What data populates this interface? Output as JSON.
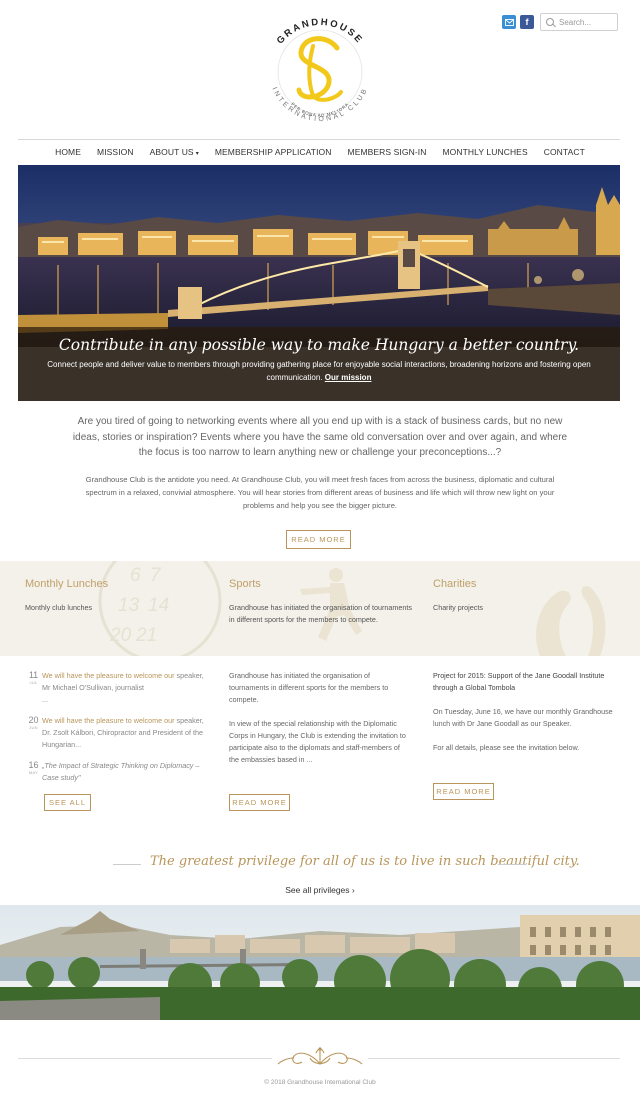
{
  "brand": {
    "name_top": "GRANDHOUSE",
    "name_bottom": "INTERNATIONAL CLUB",
    "motto": "PER BONA AD MELIORA",
    "accent": "#f2c81a"
  },
  "header": {
    "mail_icon": "mail-icon",
    "facebook_icon": "facebook-icon",
    "facebook_glyph": "f",
    "search_placeholder": "Search..."
  },
  "nav": {
    "items": [
      {
        "label": "HOME"
      },
      {
        "label": "MISSION"
      },
      {
        "label": "ABOUT US"
      },
      {
        "label": "MEMBERSHIP APPLICATION"
      },
      {
        "label": "MEMBERS SIGN-IN"
      },
      {
        "label": "MONTHLY LUNCHES"
      },
      {
        "label": "CONTACT"
      }
    ],
    "dropdown_caret": "▾"
  },
  "hero": {
    "tagline": "Contribute in any possible way to make Hungary a better country.",
    "text": "Connect people and deliver value to members through providing gathering place for enjoyable social interactions, broadening horizons and fostering open communication.",
    "link": "Our mission"
  },
  "intro": {
    "lead": "Are you tired of going to networking events where all you end up with is a stack of business cards, but no new ideas, stories or inspiration? Events where you have the same old conversation over and over again, and where the focus is too narrow to learn anything new or challenge your preconceptions...?",
    "body": "Grandhouse Club is the antidote you need. At Grandhouse Club, you will meet fresh faces from across the business, diplomatic and cultural spectrum in a relaxed, convivial atmosphere. You will hear stories from different areas of business and life which will throw new light on your problems and help you see the bigger picture.",
    "read_more": "READ MORE"
  },
  "band": {
    "lunches": {
      "title": "Monthly Lunches",
      "text": "Monthly club lunches"
    },
    "sports": {
      "title": "Sports",
      "text": "Grandhouse has initiated the organisation of tournaments in different sports for the members to compete."
    },
    "charities": {
      "title": "Charities",
      "text": "Charity projects"
    },
    "calendar_numbers": [
      "6",
      "7",
      "13",
      "14",
      "20",
      "21"
    ]
  },
  "news": {
    "items": [
      {
        "day": "11",
        "month": "JUL",
        "text": "We will have the pleasure to welcome our",
        "rest": "speaker, Mr Michael O'Sullivan, journalist",
        "tail": "..."
      },
      {
        "day": "20",
        "month": "JUN",
        "text": "We will have the pleasure to welcome our",
        "rest": "speaker, Dr. Zsolt Kálbori, Chiropractor and President of the Hungarian..."
      },
      {
        "day": "16",
        "month": "MAY",
        "text": "„The Impact of Strategic Thinking on Diplomacy – Case study\""
      }
    ],
    "see_all": "SEE ALL"
  },
  "sports_col": {
    "p1": "Grandhouse has initiated the organisation of tournaments in different sports for the members to compete.",
    "p2": "In view of the special relationship with the Diplomatic Corps in Hungary, the Club is extending the invitation to participate also to the diplomats and staff-members of the embassies based in ...",
    "read_more": "READ MORE"
  },
  "charity_col": {
    "title": "Project for 2015: Support of the Jane Goodall Institute through a Global Tombola",
    "p1": "On Tuesday, June 16, we have our monthly Grandhouse lunch with Dr Jane Goodall as our Speaker.",
    "p2": "For all details, please see the invitation below.",
    "read_more": "READ MORE"
  },
  "privilege": {
    "quote": "The greatest privilege for all of us is to live in such beautiful city.",
    "link": "See all privileges ›"
  },
  "footer": {
    "copyright": "© 2018 Grandhouse International Club"
  },
  "colors": {
    "gold": "#b8955a",
    "band_bg": "#f3f1ea",
    "nav_text": "#333333"
  }
}
